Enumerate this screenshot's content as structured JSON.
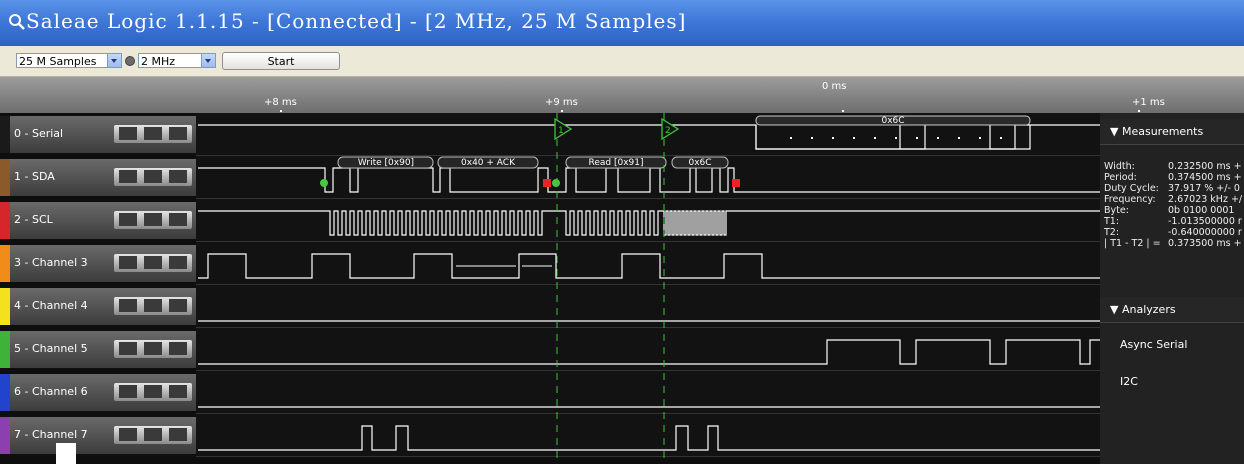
{
  "window": {
    "title": "Saleae Logic 1.1.15 - [Connected] - [2 MHz, 25 M Samples]"
  },
  "toolbar": {
    "samples": "25 M Samples",
    "rate": "2 MHz",
    "start_label": "Start"
  },
  "ruler": {
    "center": "0 ms",
    "ticks": [
      "+8 ms",
      "+9 ms",
      "+1 ms"
    ]
  },
  "channels": [
    {
      "name": "0 - Serial",
      "color": "#1a1a1a"
    },
    {
      "name": "1 - SDA",
      "color": "#8b5a2b"
    },
    {
      "name": "2 - SCL",
      "color": "#d7262b"
    },
    {
      "name": "3 - Channel 3",
      "color": "#f08c18"
    },
    {
      "name": "4 - Channel 4",
      "color": "#f3e21b"
    },
    {
      "name": "5 - Channel 5",
      "color": "#3fb23a"
    },
    {
      "name": "6 - Channel 6",
      "color": "#2244cc"
    },
    {
      "name": "7 - Channel 7",
      "color": "#8c3fb0"
    }
  ],
  "markers": {
    "t1": "1",
    "t2": "2"
  },
  "decoded": {
    "serial": [
      "0x6C"
    ],
    "i2c": [
      "Write [0x90]",
      "0x40 + ACK",
      "Read [0x91]",
      "0x6C"
    ]
  },
  "measurements": {
    "heading": "Measurements",
    "rows": [
      {
        "label": "Width:",
        "value": "0.232500 ms +"
      },
      {
        "label": "Period:",
        "value": "0.374500 ms +"
      },
      {
        "label": "Duty Cycle:",
        "value": "37.917 % +/- 0"
      },
      {
        "label": "Frequency:",
        "value": "2.67023 kHz +/"
      },
      {
        "label": "Byte:",
        "value": "0b 0100 0001"
      },
      {
        "label": "T1:",
        "value": "-1.013500000 r"
      },
      {
        "label": "T2:",
        "value": "-0.640000000 r"
      },
      {
        "label": "| T1 - T2 | =",
        "value": "0.373500 ms +"
      }
    ]
  },
  "analyzers": {
    "heading": "Analyzers",
    "items": [
      "Async Serial",
      "I2C"
    ]
  }
}
